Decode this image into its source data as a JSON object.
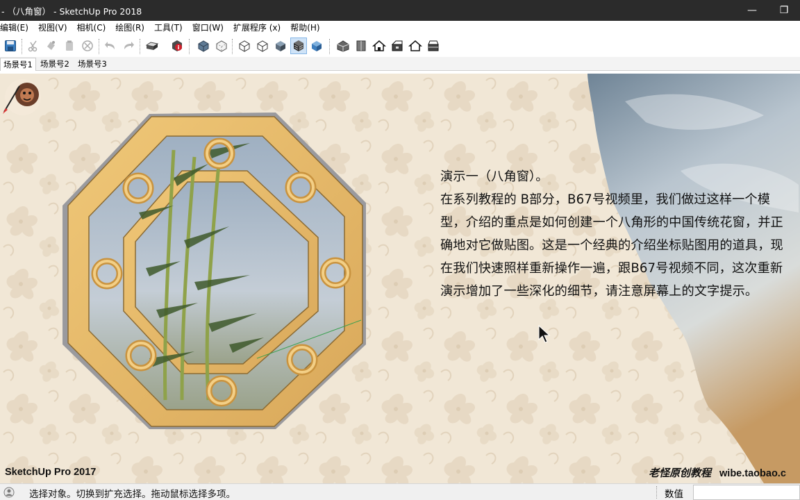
{
  "window": {
    "title": "- （八角窗） - SketchUp Pro 2018",
    "minimize_glyph": "—",
    "maximize_glyph": "❐"
  },
  "menu": {
    "items": [
      {
        "label": "编辑(E)"
      },
      {
        "label": "视图(V)"
      },
      {
        "label": "相机(C)"
      },
      {
        "label": "绘图(R)"
      },
      {
        "label": "工具(T)"
      },
      {
        "label": "窗口(W)"
      },
      {
        "label": "扩展程序 (x)"
      },
      {
        "label": "帮助(H)"
      }
    ]
  },
  "toolbar": {
    "icons": [
      "save-icon",
      "cut-icon",
      "copy-icon",
      "paste-icon",
      "erase-icon",
      "undo-icon",
      "redo-icon",
      "print-icon",
      "model-info-icon",
      "xray-icon",
      "back-edges-icon",
      "wireframe-icon",
      "hidden-line-icon",
      "shaded-icon",
      "shaded-with-textures-icon",
      "monochrome-icon",
      "iso-view-icon",
      "top-view-icon",
      "front-view-icon",
      "right-view-icon",
      "back-view-icon",
      "left-view-icon"
    ],
    "active_icon": "shaded-with-textures-icon"
  },
  "scenes": {
    "tabs": [
      {
        "label": "场景号1",
        "active": true
      },
      {
        "label": "场景号2",
        "active": false
      },
      {
        "label": "场景号3",
        "active": false
      }
    ]
  },
  "viewport": {
    "caption_lines": [
      "演示一（八角窗）。",
      "在系列教程的 B部分，B67号视频里，我们做过这样一个模",
      "型，介绍的重点是如何创建一个八角形的中国传统花窗，并正",
      "确地对它做贴图。这是一个经典的介绍坐标贴图用的道具，现",
      "在我们快速照样重新操作一遍，跟B67号视频不同，这次重新",
      "演示增加了一些深化的细节，请注意屏幕上的文字提示。"
    ],
    "watermark_left": "SketchUp Pro 2017",
    "watermark_right_author": "老怪原创教程",
    "watermark_right_site": "wibe.taobao.c",
    "background_color": "#f1e7d6",
    "frame_color": "#e6b96a",
    "logo": "lion-logo-icon"
  },
  "statusbar": {
    "message": "选择对象。切换到扩充选择。拖动鼠标选择多项。",
    "vcb_label": "数值",
    "vcb_value": ""
  }
}
